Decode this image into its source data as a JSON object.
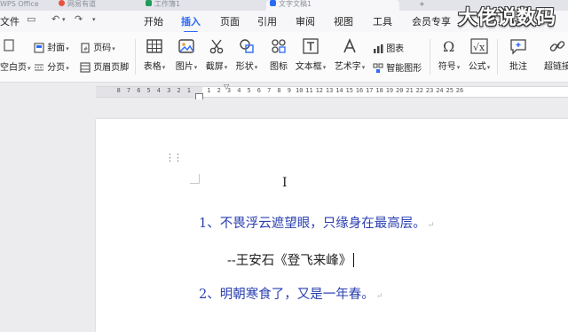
{
  "titlebar": {
    "tabs": [
      {
        "label": "WPS Office",
        "color": "#c9ccd4"
      },
      {
        "label": "网易有道",
        "color": "#e9523f"
      },
      {
        "label": "工作簿1",
        "color": "#1e9c58"
      },
      {
        "label": "文字文稿1",
        "color": "#2b6af6"
      }
    ]
  },
  "menubar": {
    "file": "文件",
    "items": [
      "开始",
      "插入",
      "页面",
      "引用",
      "审阅",
      "视图",
      "工具",
      "会员专享"
    ],
    "active": "插入"
  },
  "watermark": "大佬说数码",
  "ribbon": {
    "cover": "封面",
    "page_number": "页码",
    "blank_page": "空白页",
    "section": "分页",
    "header_footer": "页眉页脚",
    "table": "表格",
    "picture": "图片",
    "screenshot": "截屏",
    "shape": "形状",
    "icon": "图标",
    "textbox": "文本框",
    "wordart": "艺术字",
    "chart": "图表",
    "smartart": "智能图形",
    "symbol": "符号",
    "formula": "公式",
    "comment": "批注",
    "hyperlink": "超链接"
  },
  "ruler": {
    "left_numbers": [
      "8",
      "7",
      "6",
      "5",
      "4",
      "3",
      "2",
      "1"
    ],
    "right_numbers": [
      "1",
      "2",
      "3",
      "4",
      "5",
      "6",
      "7",
      "8",
      "9",
      "10",
      "11",
      "12",
      "13",
      "14",
      "15",
      "16",
      "17",
      "18",
      "19",
      "20",
      "21",
      "22",
      "23",
      "24",
      "25",
      "26"
    ]
  },
  "document": {
    "line1": "1、不畏浮云遮望眼，只缘身在最高层。",
    "line2": "--王安石《登飞来峰》",
    "line3": "2、明朝寒食了，又是一年春。",
    "para_mark": "↵"
  },
  "colors": {
    "accent": "#2b6af6",
    "text_blue": "#2a3fb0"
  }
}
